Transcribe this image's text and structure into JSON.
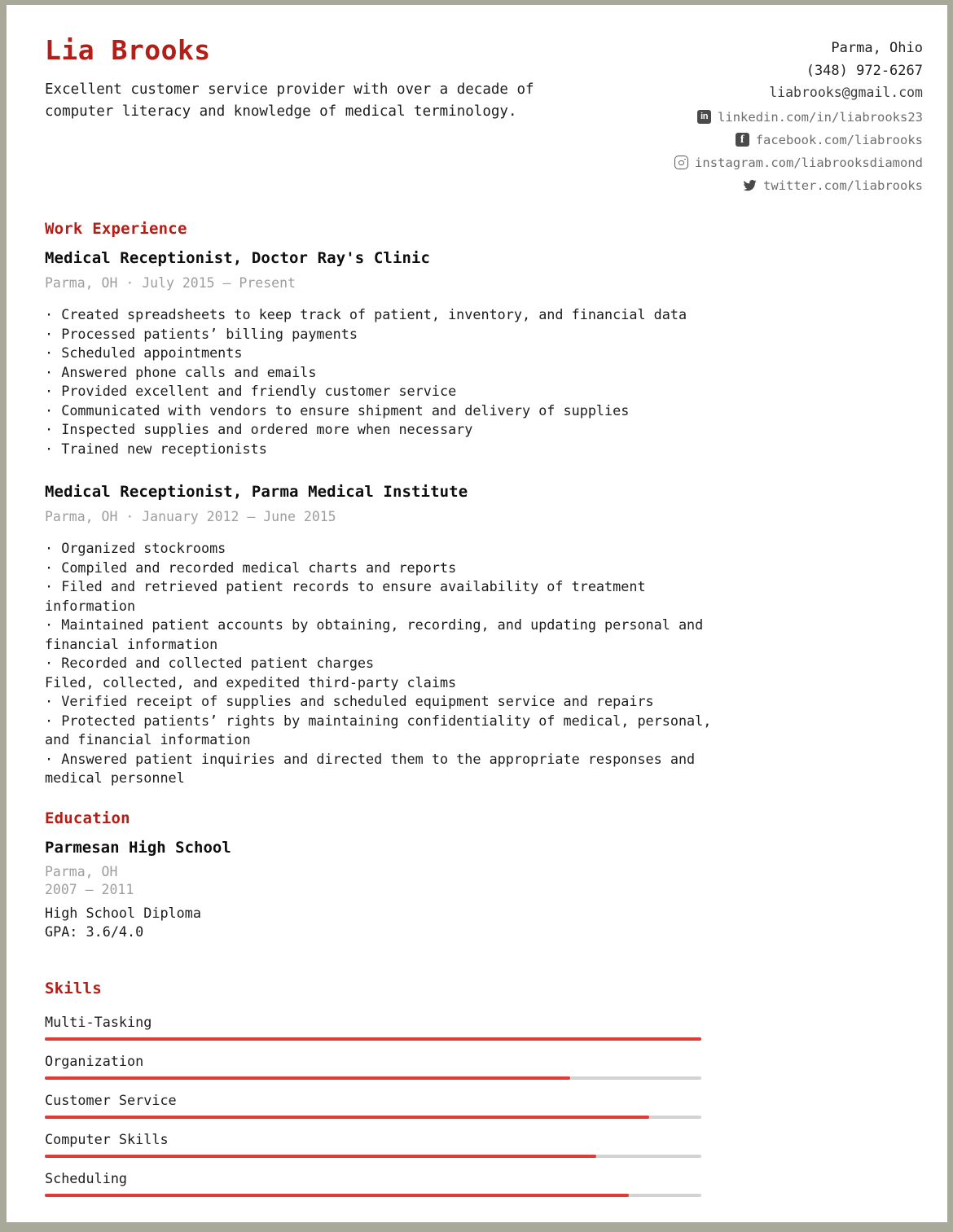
{
  "colors": {
    "accent_red": "#b51d17",
    "bar_red": "#e03a35",
    "bar_track": "#d3d3d3",
    "meta_gray": "#9d9d9d",
    "page_border": "#a9a99a"
  },
  "header": {
    "name": "Lia Brooks",
    "summary": "Excellent customer service provider with over a decade of computer literacy and knowledge of medical terminology.",
    "contact": {
      "location": "Parma, Ohio",
      "phone": "(348) 972-6267",
      "email": "liabrooks@gmail.com",
      "socials": [
        {
          "icon": "linkedin-icon",
          "label": "linkedin.com/in/liabrooks23"
        },
        {
          "icon": "facebook-icon",
          "label": "facebook.com/liabrooks"
        },
        {
          "icon": "instagram-icon",
          "label": "instagram.com/liabrooksdiamond"
        },
        {
          "icon": "twitter-icon",
          "label": "twitter.com/liabrooks"
        }
      ]
    }
  },
  "work": {
    "section_title": "Work Experience",
    "jobs": [
      {
        "title": "Medical Receptionist, Doctor Ray's Clinic",
        "meta": "Parma, OH · July 2015 — Present",
        "bullets": [
          {
            "text": "Created spreadsheets to keep track of patient, inventory, and financial data",
            "bulleted": true
          },
          {
            "text": "Processed patients’ billing payments",
            "bulleted": true
          },
          {
            "text": "Scheduled appointments",
            "bulleted": true
          },
          {
            "text": "Answered phone calls and emails",
            "bulleted": true
          },
          {
            "text": "Provided excellent and friendly customer service",
            "bulleted": true
          },
          {
            "text": "Communicated with vendors to ensure shipment and delivery of supplies",
            "bulleted": true
          },
          {
            "text": "Inspected supplies and ordered more when necessary",
            "bulleted": true
          },
          {
            "text": "Trained new receptionists",
            "bulleted": true
          }
        ]
      },
      {
        "title": "Medical Receptionist, Parma Medical Institute",
        "meta": "Parma, OH · January 2012 — June 2015",
        "bullets": [
          {
            "text": "Organized stockrooms",
            "bulleted": true
          },
          {
            "text": "Compiled and recorded medical charts and reports",
            "bulleted": true
          },
          {
            "text": "Filed and retrieved patient records to ensure availability of treatment information",
            "bulleted": true
          },
          {
            "text": "Maintained patient accounts by obtaining, recording, and updating personal and financial information",
            "bulleted": true
          },
          {
            "text": "Recorded and collected patient charges",
            "bulleted": true
          },
          {
            "text": "Filed, collected, and expedited third-party claims",
            "bulleted": false
          },
          {
            "text": "Verified receipt of supplies and scheduled equipment service and repairs",
            "bulleted": true
          },
          {
            "text": "Protected patients’ rights by maintaining confidentiality of medical, personal, and financial information",
            "bulleted": true
          },
          {
            "text": "Answered patient inquiries and directed them to the appropriate responses and medical personnel",
            "bulleted": true
          }
        ]
      }
    ]
  },
  "education": {
    "section_title": "Education",
    "school": "Parmesan High School",
    "location": "Parma, OH",
    "years": "2007 — 2011",
    "degree": "High School Diploma",
    "gpa": "GPA: 3.6/4.0"
  },
  "skills": {
    "section_title": "Skills",
    "items": [
      {
        "name": "Multi-Tasking",
        "level": 100
      },
      {
        "name": "Organization",
        "level": 80
      },
      {
        "name": "Customer Service",
        "level": 92
      },
      {
        "name": "Computer Skills",
        "level": 84
      },
      {
        "name": "Scheduling",
        "level": 89
      }
    ]
  }
}
